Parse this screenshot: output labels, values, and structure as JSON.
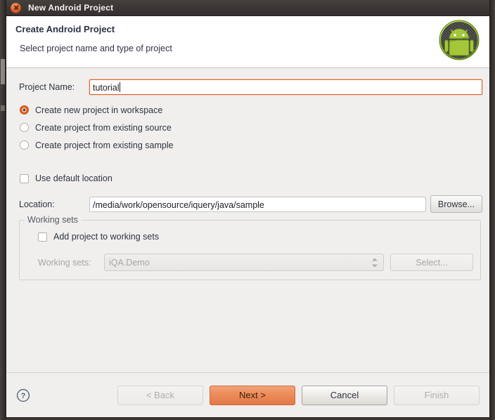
{
  "window": {
    "title": "New Android Project",
    "close_icon": "close-icon"
  },
  "header": {
    "heading": "Create Android Project",
    "subheading": "Select project name and type of project",
    "logo_icon": "android-robot-icon"
  },
  "form": {
    "project_name_label": "Project Name:",
    "project_name_value": "tutorial",
    "project_name_placeholder": "",
    "radio_options": [
      {
        "label": "Create new project in workspace",
        "selected": true
      },
      {
        "label": "Create project from existing source",
        "selected": false
      },
      {
        "label": "Create project from existing sample",
        "selected": false
      }
    ],
    "use_default_location_label": "Use default location",
    "use_default_location_checked": false,
    "location_label": "Location:",
    "location_value": "/media/work/opensource/iquery/java/sample",
    "browse_label": "Browse..."
  },
  "working_sets": {
    "group_title": "Working sets",
    "add_project_label": "Add project to working sets",
    "add_project_checked": false,
    "working_sets_label": "Working sets:",
    "working_sets_value": "iQA.Demo",
    "select_label": "Select...",
    "spinner_icon": "spinner-updown-icon"
  },
  "footer": {
    "help_icon": "help-circle-icon",
    "back_label": "< Back",
    "next_label": "Next >",
    "cancel_label": "Cancel",
    "finish_label": "Finish"
  },
  "colors": {
    "accent_orange": "#e2794a",
    "focus_orange": "#e0622a",
    "titlebar": "#3b3734",
    "dialog_bg": "#f0efee",
    "header_bg": "#ffffff",
    "android_green": "#a4c639"
  }
}
